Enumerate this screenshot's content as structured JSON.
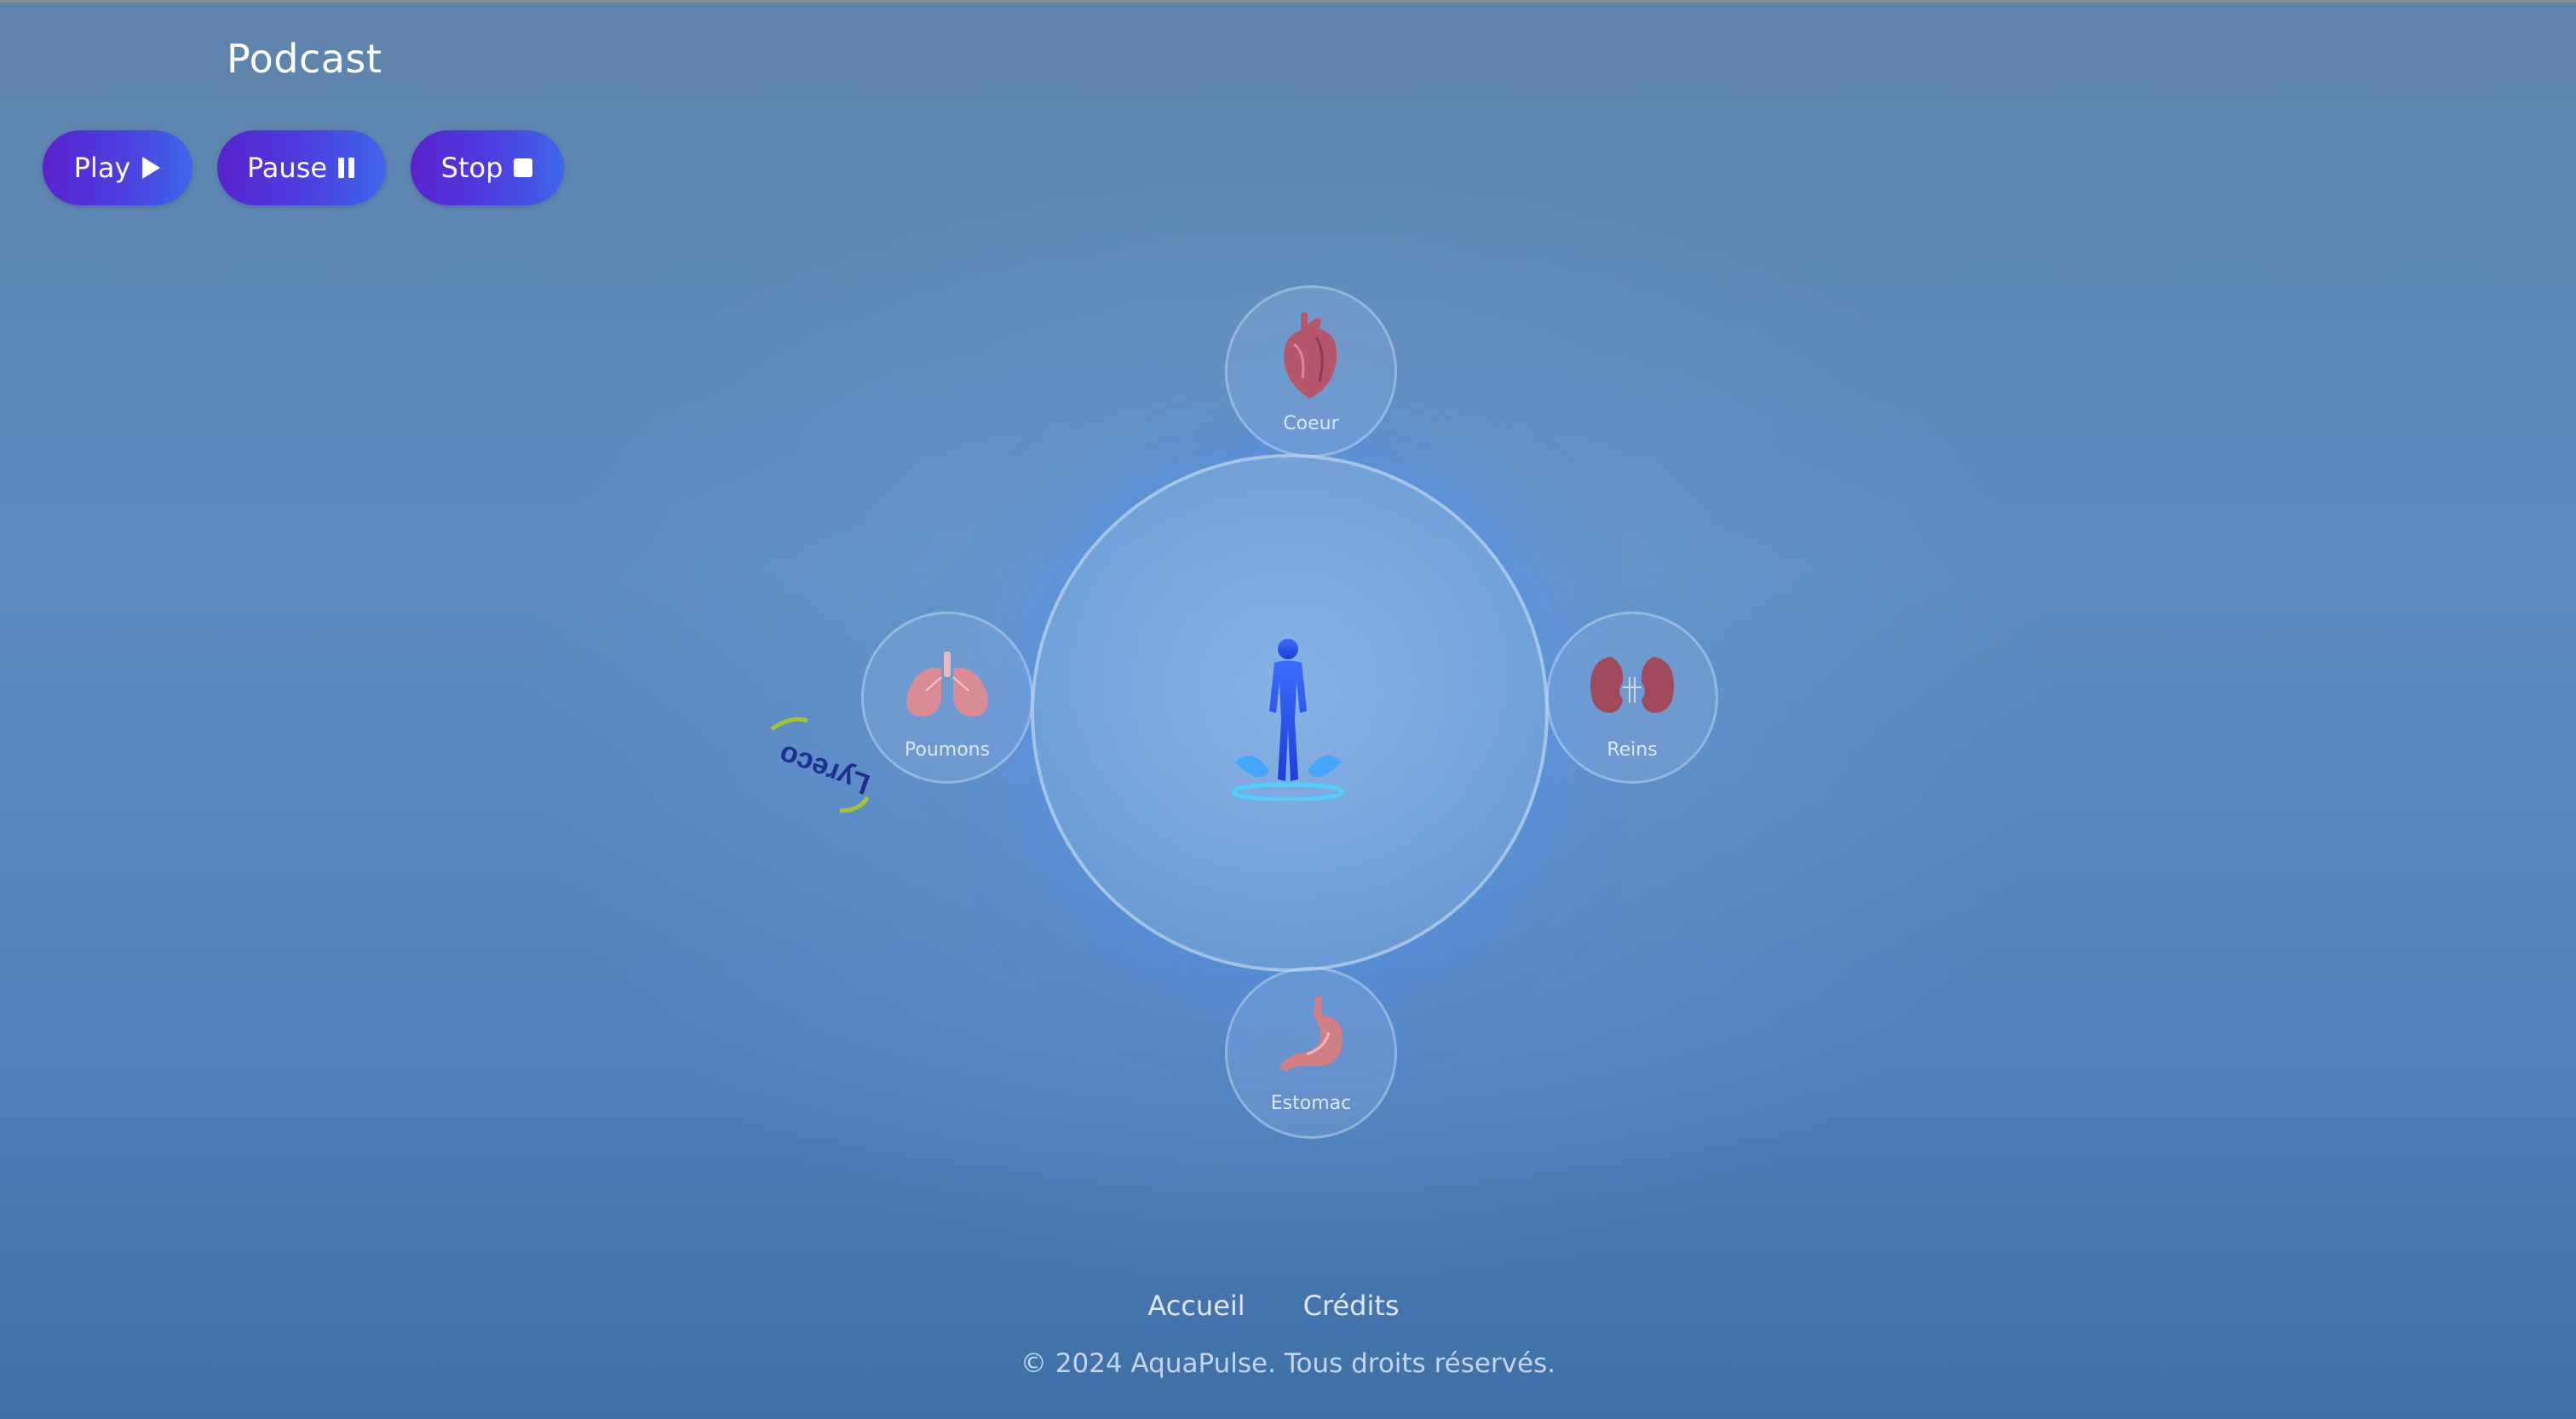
{
  "header": {
    "title": "Podcast"
  },
  "controls": {
    "play_label": "Play",
    "pause_label": "Pause",
    "stop_label": "Stop"
  },
  "hub": {
    "icon": "human-body-icon"
  },
  "organs": [
    {
      "label": "Coeur",
      "icon": "heart-icon"
    },
    {
      "label": "Poumons",
      "icon": "lungs-icon"
    },
    {
      "label": "Reins",
      "icon": "kidneys-icon"
    },
    {
      "label": "Estomac",
      "icon": "stomach-icon"
    }
  ],
  "sticker": {
    "logo_text": "Lyreco"
  },
  "footer": {
    "nav": [
      "Accueil",
      "Crédits"
    ],
    "copyright": "© 2024 AquaPulse. Tous droits réservés."
  },
  "colors": {
    "button_gradient_start": "#5a22cf",
    "button_gradient_end": "#3f66ea",
    "background_top": "#5f84ab",
    "background_bottom": "#3f6fa6"
  }
}
